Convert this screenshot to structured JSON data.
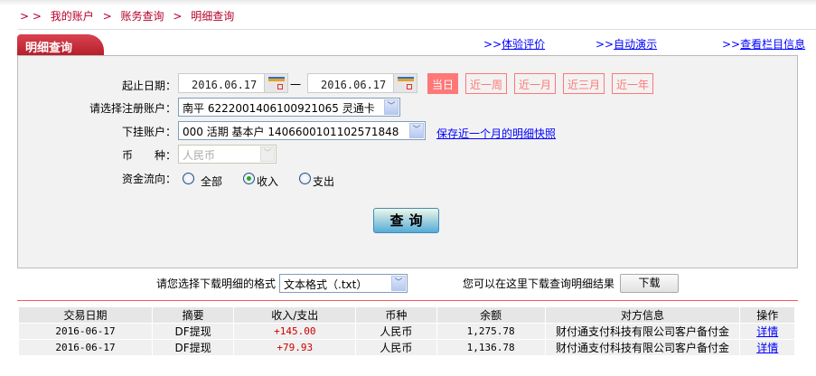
{
  "breadcrumb": {
    "prefix": "> >",
    "items": [
      "我的账户",
      "账务查询",
      "明细查询"
    ],
    "sep": ">"
  },
  "tab": {
    "title": "明细查询"
  },
  "top_links": [
    {
      "prefix": ">>",
      "label": "体验评价"
    },
    {
      "prefix": ">>",
      "label": "自动演示"
    },
    {
      "prefix": ">>",
      "label": "查看栏目信息"
    }
  ],
  "form": {
    "date_label": "起止日期：",
    "start_date": "2016.06.17",
    "dash": "一",
    "end_date": "2016.06.17",
    "quick_ranges": [
      {
        "label": "当日",
        "active": true
      },
      {
        "label": "近一周"
      },
      {
        "label": "近一月"
      },
      {
        "label": "近三月"
      },
      {
        "label": "近一年"
      }
    ],
    "account_label": "请选择注册账户：",
    "account_value": "南平 6222001406100921065 灵通卡",
    "sub_label": "下挂账户：",
    "sub_value": "000 活期 基本户 1406600101102571848",
    "snapshot_link": "保存近一个月的明细快照",
    "currency_label": "币　　种：",
    "currency_value": "人民币",
    "flow_label": "资金流向：",
    "flow_options": [
      {
        "label": "全部",
        "checked": false
      },
      {
        "label": "收入",
        "checked": true
      },
      {
        "label": "支出",
        "checked": false
      }
    ],
    "query_button": "查询"
  },
  "download": {
    "format_label": "请您选择下载明细的格式",
    "format_value": "文本格式（.txt）",
    "hint": "您可以在这里下载查询明细结果",
    "button": "下载"
  },
  "table": {
    "headers": [
      "交易日期",
      "摘要",
      "收入/支出",
      "币种",
      "余额",
      "对方信息",
      "操作"
    ],
    "rows": [
      [
        "2016-06-17",
        "DF提现",
        "+145.00",
        "人民币",
        "1,275.78",
        "财付通支付科技有限公司客户备付金",
        "详情"
      ],
      [
        "2016-06-17",
        "DF提现",
        "+79.93",
        "人民币",
        "1,136.78",
        "财付通支付科技有限公司客户备付金",
        "详情"
      ]
    ]
  },
  "colors": {
    "brand_red": "#b51d2b",
    "accent_pink": "#ff7777",
    "link_blue": "#0000ff"
  }
}
